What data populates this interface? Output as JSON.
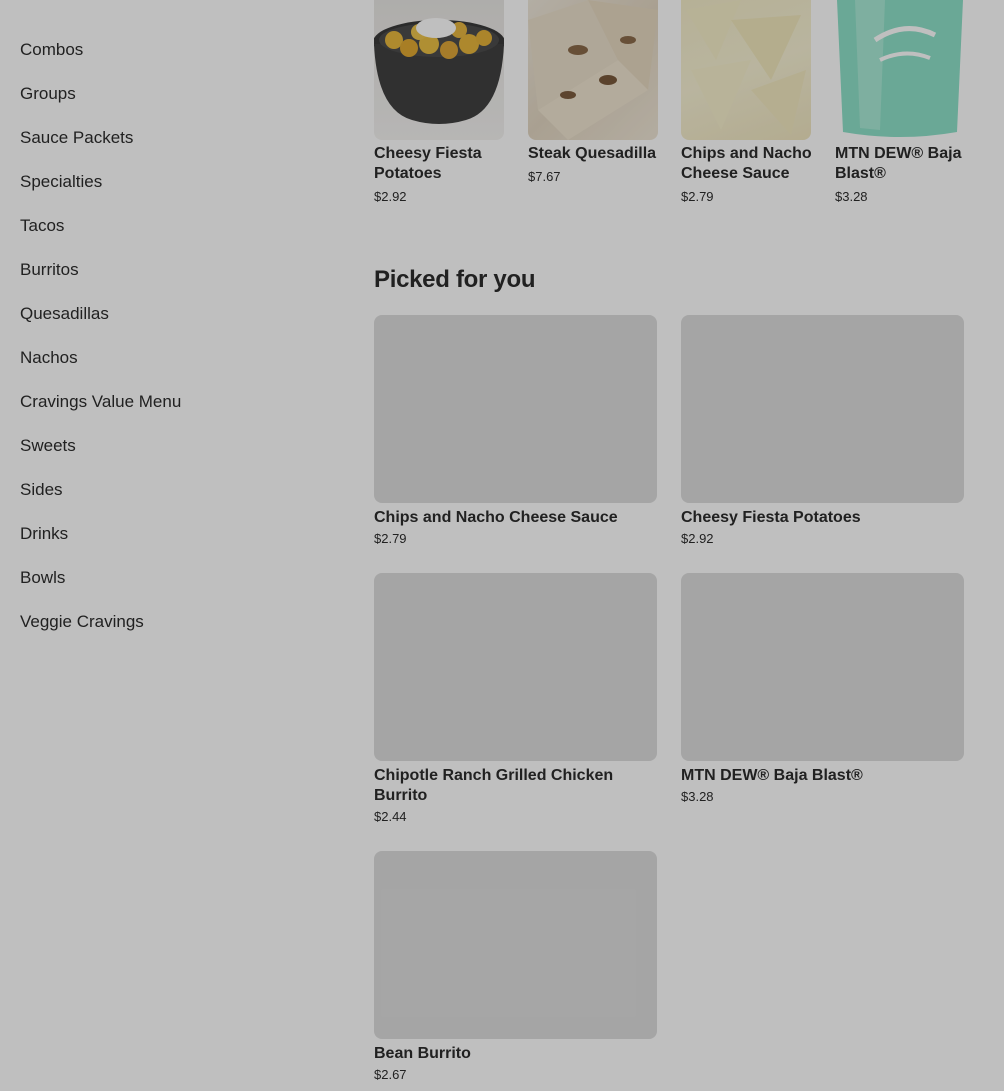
{
  "sidebar": {
    "items": [
      {
        "label": "Combos"
      },
      {
        "label": "Groups"
      },
      {
        "label": "Sauce Packets"
      },
      {
        "label": "Specialties"
      },
      {
        "label": "Tacos"
      },
      {
        "label": "Burritos"
      },
      {
        "label": "Quesadillas"
      },
      {
        "label": "Nachos"
      },
      {
        "label": "Cravings Value Menu"
      },
      {
        "label": "Sweets"
      },
      {
        "label": "Sides"
      },
      {
        "label": "Drinks"
      },
      {
        "label": "Bowls"
      },
      {
        "label": "Veggie Cravings"
      }
    ]
  },
  "top_items": [
    {
      "name": "Cheesy Fiesta Potatoes",
      "price": "$2.92"
    },
    {
      "name": "Steak Quesadilla",
      "price": "$7.67"
    },
    {
      "name": "Chips and Nacho Cheese Sauce",
      "price": "$2.79"
    },
    {
      "name": "MTN DEW® Baja Blast®",
      "price": "$3.28"
    }
  ],
  "picked_for_you": {
    "title": "Picked for you",
    "items": [
      {
        "name": "Chips and Nacho Cheese Sauce",
        "price": "$2.79"
      },
      {
        "name": "Cheesy Fiesta Potatoes",
        "price": "$2.92"
      },
      {
        "name": "Chipotle Ranch Grilled Chicken Burrito",
        "price": "$2.44"
      },
      {
        "name": "MTN DEW® Baja Blast®",
        "price": "$3.28"
      },
      {
        "name": "Bean Burrito",
        "price": "$2.67"
      }
    ]
  },
  "colors": {
    "text": "#2d2d2d",
    "image_placeholder": "#dddddd",
    "overlay": "rgba(0,0,0,0.25)"
  }
}
